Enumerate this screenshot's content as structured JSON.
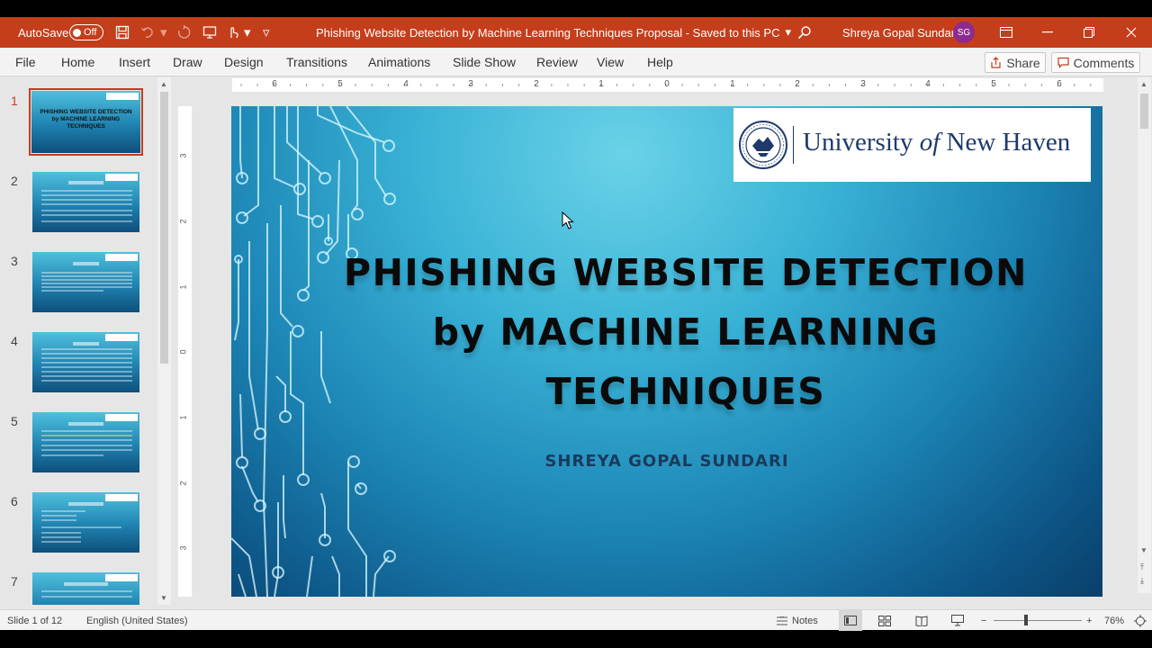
{
  "titlebar": {
    "autosave_label": "AutoSave",
    "autosave_state": "Off",
    "doc_title": "Phishing Website Detection by Machine Learning Techniques Proposal  -  Saved to this PC",
    "dropdown_glyph": "▾",
    "user_name": "Shreya Gopal Sundari",
    "user_initials": "SG"
  },
  "ribbon": {
    "tabs": [
      "File",
      "Home",
      "Insert",
      "Draw",
      "Design",
      "Transitions",
      "Animations",
      "Slide Show",
      "Review",
      "View",
      "Help"
    ],
    "share_label": "Share",
    "comments_label": "Comments"
  },
  "thumbnails": [
    {
      "num": "1",
      "title": "PHISHING WEBSITE DETECTION by MACHINE LEARNING TECHNIQUES"
    },
    {
      "num": "2"
    },
    {
      "num": "3"
    },
    {
      "num": "4"
    },
    {
      "num": "5"
    },
    {
      "num": "6"
    },
    {
      "num": "7"
    }
  ],
  "ruler": {
    "horizontal": [
      "6",
      "5",
      "4",
      "3",
      "2",
      "1",
      "0",
      "1",
      "2",
      "3",
      "4",
      "5",
      "6"
    ],
    "vertical": [
      "3",
      "2",
      "1",
      "0",
      "1",
      "2",
      "3"
    ]
  },
  "slide": {
    "logo_name_1": "University ",
    "logo_name_of": "of",
    "logo_name_2": " New Haven",
    "title_line1": "PHISHING WEBSITE DETECTION",
    "title_line2": "by MACHINE LEARNING",
    "title_line3": "TECHNIQUES",
    "subtitle": "SHREYA GOPAL SUNDARI"
  },
  "statusbar": {
    "slide_counter": "Slide 1 of 12",
    "language": "English (United States)",
    "notes_label": "Notes",
    "zoom_minus": "−",
    "zoom_plus": "+",
    "zoom_level": "76%"
  },
  "colors": {
    "accent": "#c43e1c",
    "avatar": "#8e2b8e"
  }
}
